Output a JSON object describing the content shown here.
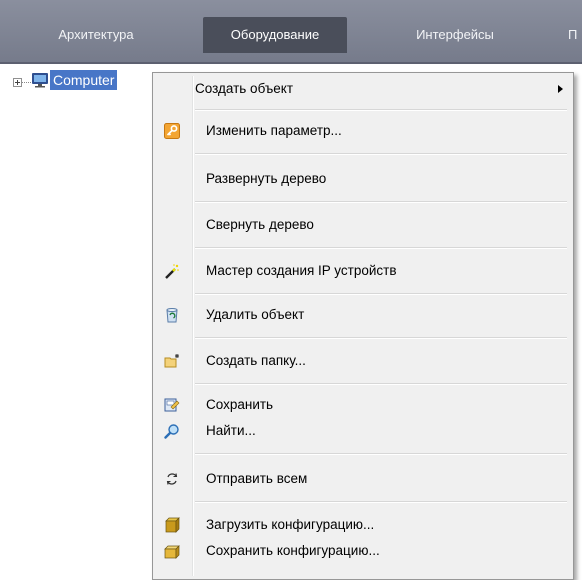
{
  "tabs": [
    {
      "label": "Архитектура",
      "active": false
    },
    {
      "label": "Оборудование",
      "active": true
    },
    {
      "label": "Интерфейсы",
      "active": false
    },
    {
      "label": "П",
      "active": false
    }
  ],
  "tree": {
    "root_label": "Computer",
    "root_icon": "computer-icon",
    "expander_icon": "plus-box-icon"
  },
  "menu": {
    "submenu_label": "Создать объект",
    "items": [
      {
        "label": "Изменить параметр...",
        "icon": "key-icon"
      },
      {
        "label": "Развернуть дерево",
        "icon": ""
      },
      {
        "label": "Свернуть дерево",
        "icon": ""
      },
      {
        "label": "Мастер создания IP устройств",
        "icon": "wand-icon"
      },
      {
        "label": "Удалить объект",
        "icon": "recycle-bin-icon"
      },
      {
        "label": "Создать папку...",
        "icon": "new-folder-icon"
      },
      {
        "label": "Сохранить",
        "icon": "save-icon"
      },
      {
        "label": "Найти...",
        "icon": "magnifier-icon"
      },
      {
        "label": "Отправить всем",
        "icon": "refresh-arrows-icon"
      },
      {
        "label": "Загрузить конфигурацию...",
        "icon": "load-config-box-icon"
      },
      {
        "label": "Сохранить конфигурацию...",
        "icon": "save-config-box-icon"
      }
    ]
  },
  "colors": {
    "tabbar": "#7f8494",
    "active_tab": "#4a4e5a",
    "selection": "#4876c7",
    "menu_bg": "#f0f0f0"
  }
}
